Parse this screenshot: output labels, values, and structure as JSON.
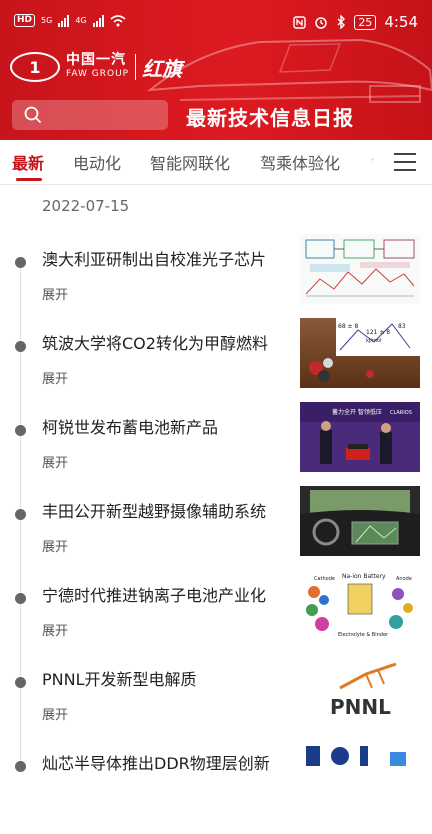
{
  "status_bar": {
    "time": "4:54",
    "battery": "25",
    "hd": "HD",
    "net1": "5G",
    "net2": "4G"
  },
  "brand": {
    "name_cn": "中国一汽",
    "name_en": "FAW GROUP",
    "script": "红旗"
  },
  "header": {
    "title": "最新技术信息日报"
  },
  "tabs": [
    "最新",
    "电动化",
    "智能网联化",
    "驾乘体验化",
    "·"
  ],
  "date": "2022-07-15",
  "expand_label": "展开",
  "colors": {
    "brand_red": "#c8141b"
  },
  "items": [
    {
      "title": "澳大利亚研制出自校准光子芯片"
    },
    {
      "title": "筑波大学将CO2转化为甲醇燃料"
    },
    {
      "title": "柯锐世发布蓄电池新产品"
    },
    {
      "title": "丰田公开新型越野摄像辅助系统"
    },
    {
      "title": "宁德时代推进钠离子电池产业化"
    },
    {
      "title": "PNNL开发新型电解质"
    },
    {
      "title": "灿芯半导体推出DDR物理层创新"
    }
  ],
  "thumb_text": {
    "co2_a": "68 ± 8",
    "co2_b": "121 ± 8",
    "co2_c": "83",
    "unit": "kJ/mol",
    "clarios_slogan": "蓄力全开 智领低压",
    "clarios_brand": "CLARIOS",
    "battery_title": "Na-ion Battery",
    "cathode": "Cathode",
    "anode": "Anode",
    "electrolyte": "Electrolyte & Binder",
    "pnnl": "PNNL"
  }
}
